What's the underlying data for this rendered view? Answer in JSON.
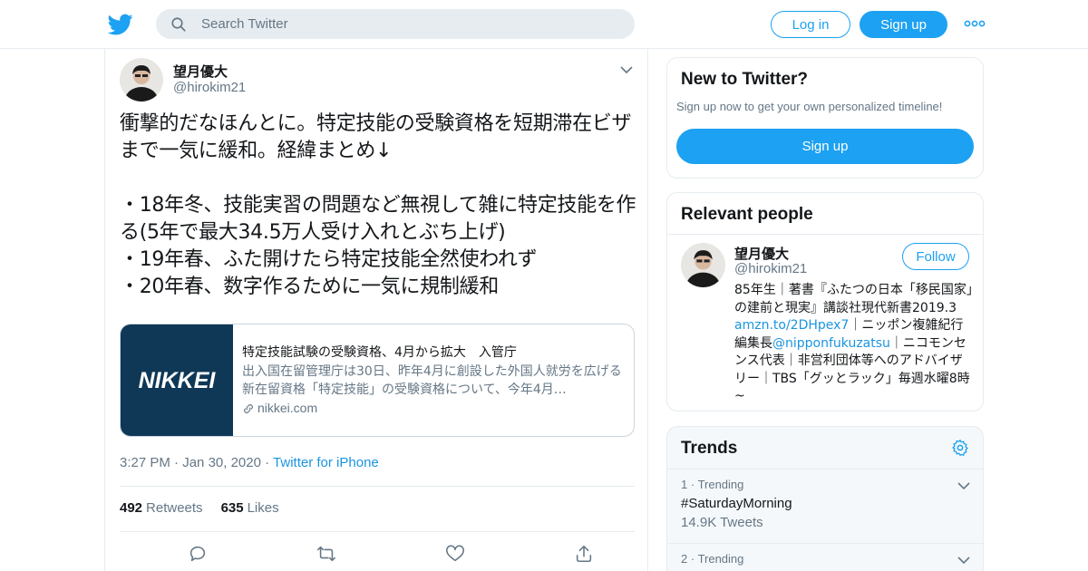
{
  "header": {
    "search_placeholder": "Search Twitter",
    "login_label": "Log in",
    "signup_label": "Sign up",
    "logo_icon": "twitter-bird-icon",
    "more_icon": "more-dots-icon",
    "brand_color": "#1da1f2"
  },
  "tweet": {
    "author_name": "望月優大",
    "author_handle": "@hirokim21",
    "text": "衝撃的だなほんとに。特定技能の受験資格を短期滞在ビザまで一気に緩和。経緯まとめ↓\n\n・18年冬、技能実習の問題など無視して雑に特定技能を作る(5年で最大34.5万人受け入れとぶち上げ)\n・19年春、ふた開けたら特定技能全然使われず\n・20年春、数字作るために一気に規制緩和",
    "card": {
      "image_text": "NIKKEI",
      "title": "特定技能試験の受験資格、4月から拡大　入管庁",
      "description": "出入国在留管理庁は30日、昨年4月に創設した外国人就労を広げる新在留資格「特定技能」の受験資格について、今年4月…",
      "domain": "nikkei.com"
    },
    "time": "3:27 PM",
    "date": "Jan 30, 2020",
    "source": "Twitter for iPhone",
    "retweets_count": "492",
    "retweets_label": "Retweets",
    "likes_count": "635",
    "likes_label": "Likes"
  },
  "sidebar": {
    "new_to_twitter": {
      "title": "New to Twitter?",
      "subtitle": "Sign up now to get your own personalized timeline!",
      "button_label": "Sign up"
    },
    "relevant_people": {
      "title": "Relevant people",
      "name": "望月優大",
      "handle": "@hirokim21",
      "follow_label": "Follow",
      "bio_part1": "85年生｜著書『ふたつの日本「移民国家」の建前と現実』講談社現代新書2019.3 ",
      "bio_link1": "amzn.to/2DHpex7",
      "bio_part2": "｜ニッポン複雑紀行編集長",
      "bio_link2": "@nipponfukuzatsu",
      "bio_part3": "｜ニコモンセンス代表｜非営利団体等へのアドバイザリー｜TBS「グッとラック」毎週水曜8時~"
    },
    "trends": {
      "title": "Trends",
      "items": [
        {
          "rank": "1",
          "label": "Trending",
          "name": "#SaturdayMorning",
          "count": "14.9K Tweets"
        },
        {
          "rank": "2",
          "label": "Trending",
          "name": "",
          "count": ""
        }
      ]
    }
  }
}
